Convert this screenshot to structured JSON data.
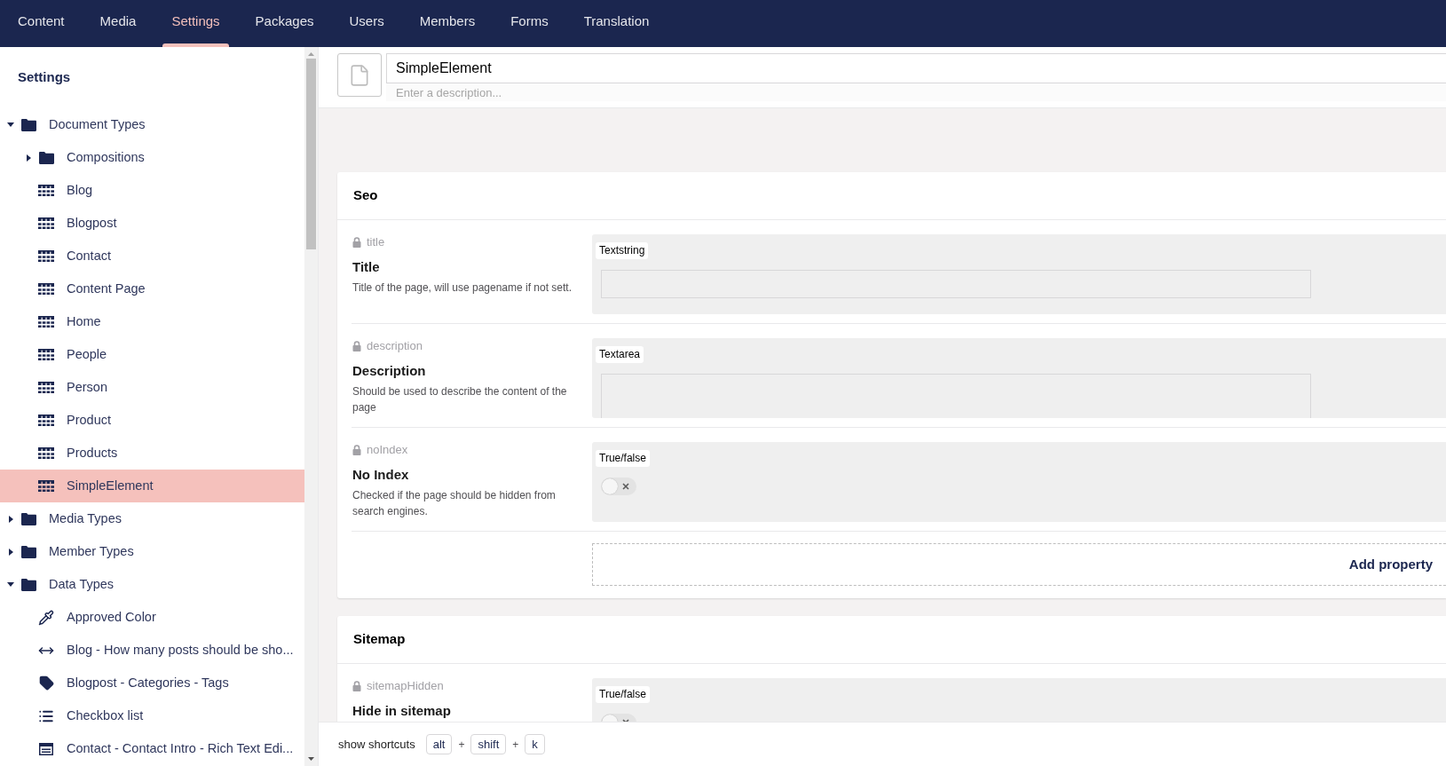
{
  "top_nav": {
    "items": [
      {
        "label": "Content",
        "selected": false
      },
      {
        "label": "Media",
        "selected": false
      },
      {
        "label": "Settings",
        "selected": true
      },
      {
        "label": "Packages",
        "selected": false
      },
      {
        "label": "Users",
        "selected": false
      },
      {
        "label": "Members",
        "selected": false
      },
      {
        "label": "Forms",
        "selected": false
      },
      {
        "label": "Translation",
        "selected": false
      }
    ]
  },
  "sidebar": {
    "title": "Settings",
    "tree": [
      {
        "label": "Document Types",
        "kind": "folder",
        "expanded": true,
        "selected": false,
        "children": [
          {
            "label": "Compositions",
            "kind": "folder",
            "expanded": false,
            "selected": false
          },
          {
            "label": "Blog",
            "kind": "document-type",
            "selected": false
          },
          {
            "label": "Blogpost",
            "kind": "document-type",
            "selected": false
          },
          {
            "label": "Contact",
            "kind": "document-type",
            "selected": false
          },
          {
            "label": "Content Page",
            "kind": "document-type",
            "selected": false
          },
          {
            "label": "Home",
            "kind": "document-type",
            "selected": false
          },
          {
            "label": "People",
            "kind": "document-type",
            "selected": false
          },
          {
            "label": "Person",
            "kind": "document-type",
            "selected": false
          },
          {
            "label": "Product",
            "kind": "document-type",
            "selected": false
          },
          {
            "label": "Products",
            "kind": "document-type",
            "selected": false
          },
          {
            "label": "SimpleElement",
            "kind": "document-type",
            "selected": true
          }
        ]
      },
      {
        "label": "Media Types",
        "kind": "folder",
        "expanded": false,
        "selected": false
      },
      {
        "label": "Member Types",
        "kind": "folder",
        "expanded": false,
        "selected": false
      },
      {
        "label": "Data Types",
        "kind": "folder",
        "expanded": true,
        "selected": false,
        "children": [
          {
            "label": "Approved Color",
            "kind": "color-picker",
            "selected": false
          },
          {
            "label": "Blog - How many posts should be sho...",
            "kind": "slider",
            "selected": false
          },
          {
            "label": "Blogpost - Categories - Tags",
            "kind": "tags",
            "selected": false
          },
          {
            "label": "Checkbox list",
            "kind": "checkbox-list",
            "selected": false
          },
          {
            "label": "Contact - Contact Intro - Rich Text Edi...",
            "kind": "rich-text",
            "selected": false
          }
        ]
      }
    ]
  },
  "editor": {
    "name": "SimpleElement",
    "description_placeholder": "Enter a description...",
    "groups": [
      {
        "title": "Seo",
        "properties": [
          {
            "alias": "title",
            "label": "Title",
            "description": "Title of the page, will use pagename if not sett.",
            "editor": "Textstring",
            "kind": "textstring"
          },
          {
            "alias": "description",
            "label": "Description",
            "description": "Should be used to describe the content of the page",
            "editor": "Textarea",
            "kind": "textarea"
          },
          {
            "alias": "noIndex",
            "label": "No Index",
            "description": "Checked if the page should be hidden from search engines.",
            "editor": "True/false",
            "kind": "toggle",
            "on": false
          }
        ],
        "add_property": "Add property"
      },
      {
        "title": "Sitemap",
        "properties": [
          {
            "alias": "sitemapHidden",
            "label": "Hide in sitemap",
            "editor": "True/false",
            "kind": "toggle",
            "on": false
          }
        ]
      }
    ]
  },
  "footer": {
    "label": "show shortcuts",
    "shortcut": [
      {
        "kind": "key",
        "text": "alt"
      },
      {
        "kind": "separator",
        "text": "+"
      },
      {
        "kind": "key",
        "text": "shift"
      },
      {
        "kind": "separator",
        "text": "+"
      },
      {
        "kind": "key",
        "text": "k"
      }
    ]
  }
}
